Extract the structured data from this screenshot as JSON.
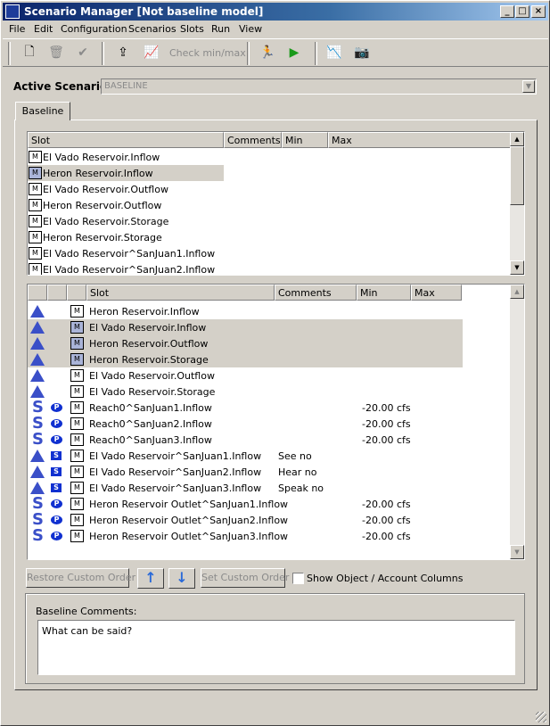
{
  "window": {
    "title": "Scenario Manager [Not baseline model]"
  },
  "menu": [
    "File",
    "Edit",
    "Configuration",
    "Scenarios",
    "Slots",
    "Run",
    "View"
  ],
  "toolbar": {
    "check_label": "Check min/max"
  },
  "active_scenario": {
    "label": "Active Scenario:",
    "value": "BASELINE"
  },
  "tab": {
    "label": "Baseline"
  },
  "top_table": {
    "headers": [
      "Slot",
      "Comments",
      "Min",
      "Max"
    ],
    "rows": [
      {
        "slot": "El Vado Reservoir.Inflow",
        "selected": false
      },
      {
        "slot": "Heron Reservoir.Inflow",
        "selected": true
      },
      {
        "slot": "El Vado Reservoir.Outflow",
        "selected": false
      },
      {
        "slot": "Heron Reservoir.Outflow",
        "selected": false
      },
      {
        "slot": "El Vado Reservoir.Storage",
        "selected": false
      },
      {
        "slot": "Heron Reservoir.Storage",
        "selected": false
      },
      {
        "slot": "El Vado Reservoir^SanJuan1.Inflow",
        "selected": false
      },
      {
        "slot": "El Vado Reservoir^SanJuan2.Inflow",
        "selected": false
      }
    ]
  },
  "bottom_table": {
    "headers": [
      "",
      "",
      "",
      "Slot",
      "Comments",
      "Min",
      "Max"
    ],
    "rows": [
      {
        "type": "reservoir",
        "badge": "",
        "slot": "Heron Reservoir.Inflow",
        "comment": "",
        "min": "",
        "selected": false
      },
      {
        "type": "reservoir",
        "badge": "",
        "slot": "El Vado Reservoir.Inflow",
        "comment": "",
        "min": "",
        "selected": true
      },
      {
        "type": "reservoir",
        "badge": "",
        "slot": "Heron Reservoir.Outflow",
        "comment": "",
        "min": "",
        "selected": true
      },
      {
        "type": "reservoir",
        "badge": "",
        "slot": "Heron Reservoir.Storage",
        "comment": "",
        "min": "",
        "selected": true
      },
      {
        "type": "reservoir",
        "badge": "",
        "slot": "El Vado Reservoir.Outflow",
        "comment": "",
        "min": "",
        "selected": false
      },
      {
        "type": "reservoir",
        "badge": "",
        "slot": "El Vado Reservoir.Storage",
        "comment": "",
        "min": "",
        "selected": false
      },
      {
        "type": "reach",
        "badge": "P",
        "slot": "Reach0^SanJuan1.Inflow",
        "comment": "",
        "min": "-20.00 cfs",
        "selected": false
      },
      {
        "type": "reach",
        "badge": "P",
        "slot": "Reach0^SanJuan2.Inflow",
        "comment": "",
        "min": "-20.00 cfs",
        "selected": false
      },
      {
        "type": "reach",
        "badge": "P",
        "slot": "Reach0^SanJuan3.Inflow",
        "comment": "",
        "min": "-20.00 cfs",
        "selected": false
      },
      {
        "type": "reservoir",
        "badge": "S",
        "slot": "El Vado Reservoir^SanJuan1.Inflow",
        "comment": "See no",
        "min": "",
        "selected": false
      },
      {
        "type": "reservoir",
        "badge": "S",
        "slot": "El Vado Reservoir^SanJuan2.Inflow",
        "comment": "Hear no",
        "min": "",
        "selected": false
      },
      {
        "type": "reservoir",
        "badge": "S",
        "slot": "El Vado Reservoir^SanJuan3.Inflow",
        "comment": "Speak no",
        "min": "",
        "selected": false
      },
      {
        "type": "reach",
        "badge": "P",
        "slot": "Heron Reservoir Outlet^SanJuan1.Inflow",
        "comment": "",
        "min": "-20.00 cfs",
        "selected": false
      },
      {
        "type": "reach",
        "badge": "P",
        "slot": "Heron Reservoir Outlet^SanJuan2.Inflow",
        "comment": "",
        "min": "-20.00 cfs",
        "selected": false
      },
      {
        "type": "reach",
        "badge": "P",
        "slot": "Heron Reservoir Outlet^SanJuan3.Inflow",
        "comment": "",
        "min": "-20.00 cfs",
        "selected": false
      }
    ]
  },
  "buttons": {
    "restore": "Restore Custom Order",
    "set": "Set Custom Order",
    "show_columns": "Show Object / Account Columns"
  },
  "comments": {
    "label": "Baseline Comments:",
    "text": "What can be said?"
  },
  "icons": {
    "slot": "series-slot-icon",
    "reservoir": "reservoir-triangle-icon",
    "reach": "reach-squiggle-icon"
  },
  "colors": {
    "title_start": "#0a246a",
    "title_end": "#a6caf0",
    "icon_blue": "#3a4fc8",
    "badge_blue": "#1030d0",
    "selection": "#d4d0c8"
  }
}
